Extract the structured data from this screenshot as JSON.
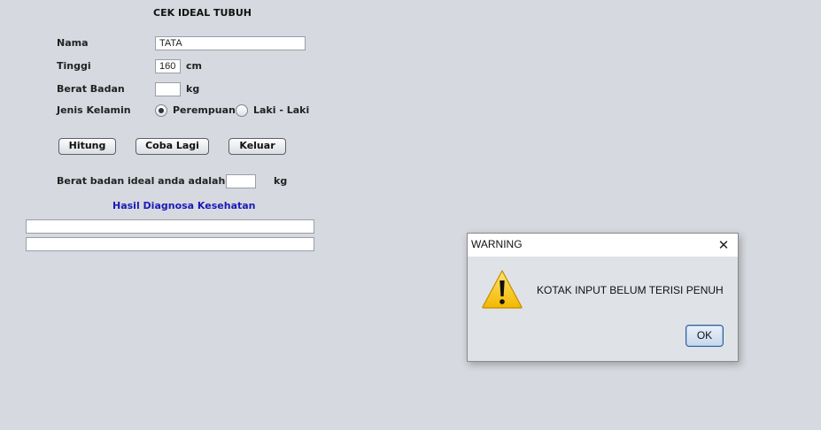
{
  "form": {
    "title": "CEK IDEAL TUBUH",
    "nama_label": "Nama",
    "nama_value": "TATA",
    "tinggi_label": "Tinggi",
    "tinggi_value": "160",
    "tinggi_unit": "cm",
    "berat_label": "Berat Badan",
    "berat_value": "",
    "berat_unit": "kg",
    "kelamin_label": "Jenis Kelamin",
    "kelamin_options": [
      "Perempuan",
      "Laki - Laki"
    ],
    "kelamin_selected": "Perempuan"
  },
  "buttons": {
    "hitung": "Hitung",
    "coba_lagi": "Coba Lagi",
    "keluar": "Keluar"
  },
  "result": {
    "ideal_label": "Berat badan ideal anda adalah",
    "ideal_value": "",
    "ideal_unit": "kg",
    "diagnosa_title": "Hasil Diagnosa Kesehatan",
    "diagnosa_line1": "",
    "diagnosa_line2": ""
  },
  "dialog": {
    "title": "WARNING",
    "close_glyph": "✕",
    "message": "KOTAK INPUT BELUM TERISI PENUH",
    "ok_label": "OK",
    "icon": "warning-icon",
    "icon_color": "#f5c400"
  }
}
